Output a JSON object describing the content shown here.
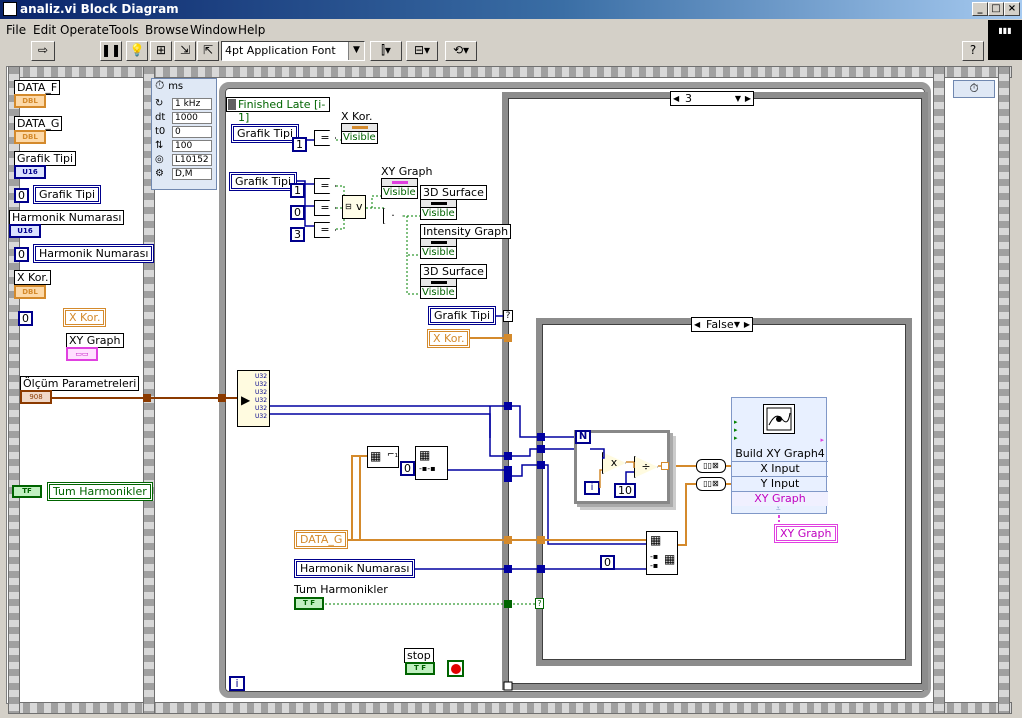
{
  "window": {
    "title": "analiz.vi Block Diagram",
    "buttons": {
      "minimize": "_",
      "maximize": "□",
      "close": "×"
    }
  },
  "menubar": {
    "items": [
      "File",
      "Edit",
      "Operate",
      "Tools",
      "Browse",
      "Window",
      "Help"
    ]
  },
  "toolbar": {
    "font": "4pt Application Font",
    "help": "?"
  },
  "left_panel": {
    "items": [
      {
        "label": "DATA_F",
        "type": "DBL"
      },
      {
        "label": "DATA_G",
        "type": "DBL"
      },
      {
        "label": "Grafik Tipi",
        "type": "U16"
      },
      {
        "const": "0",
        "label": "Grafik Tipi"
      },
      {
        "label": "Harmonik Numarası",
        "type": "U16"
      },
      {
        "const": "0",
        "label": "Harmonik Numarası"
      },
      {
        "label": "X Kor.",
        "type": "DBL"
      },
      {
        "const": "0",
        "label": "X Kor."
      },
      {
        "label": "XY Graph"
      },
      {
        "label": "Ölçüm Parametreleri"
      },
      {
        "label": "Tum Harmonikler",
        "type": "TF"
      }
    ]
  },
  "timed_loop": {
    "period_unit": "ms",
    "rows": [
      {
        "key": "",
        "value": "1 kHz"
      },
      {
        "key": "dt",
        "value": "1000"
      },
      {
        "key": "t0",
        "value": "0"
      },
      {
        "key": "",
        "value": "100"
      },
      {
        "key": "",
        "value": "L10152"
      },
      {
        "key": "",
        "value": "D,M"
      }
    ],
    "finished_late": "Finished Late [i-1]",
    "iteration": "i"
  },
  "case_outer": {
    "selector": "3",
    "nodes": {
      "grafik_tipi_1": "Grafik Tipi",
      "const_1": "1",
      "eq": "=",
      "x_kor_prop": "X Kor.",
      "visible": "Visible",
      "grafik_tipi_2": "Grafik Tipi",
      "xy_graph_prop": "XY Graph",
      "surface_1": "3D Surface",
      "intensity": "Intensity Graph",
      "surface_2": "3D Surface",
      "consts": [
        "1",
        "0",
        "3"
      ],
      "or_label": "v",
      "grafik_tipi_term": "Grafik Tipi",
      "x_kor_term": "X Kor.",
      "data_g": "DATA_G",
      "harmonik": "Harmonik Numarası",
      "tum_harmonikler": "Tum Harmonikler",
      "stop": "stop",
      "const_0a": "0",
      "const_0b": "0",
      "question": "?"
    }
  },
  "case_inner": {
    "selector": "False",
    "for_loop_count": "N",
    "for_loop_i": "i",
    "const_10": "10",
    "mul": "x",
    "div": "÷",
    "build_xy": {
      "title": "Build XY Graph4",
      "inputs": [
        "X Input",
        "Y Input",
        "XY Graph"
      ]
    },
    "xy_graph_out": "XY Graph"
  },
  "colors": {
    "dbl": "#d48a2c",
    "u16": "#00008c",
    "bool": "#006400",
    "cluster": "#8b3a00",
    "dynamic": "#c000c0"
  }
}
